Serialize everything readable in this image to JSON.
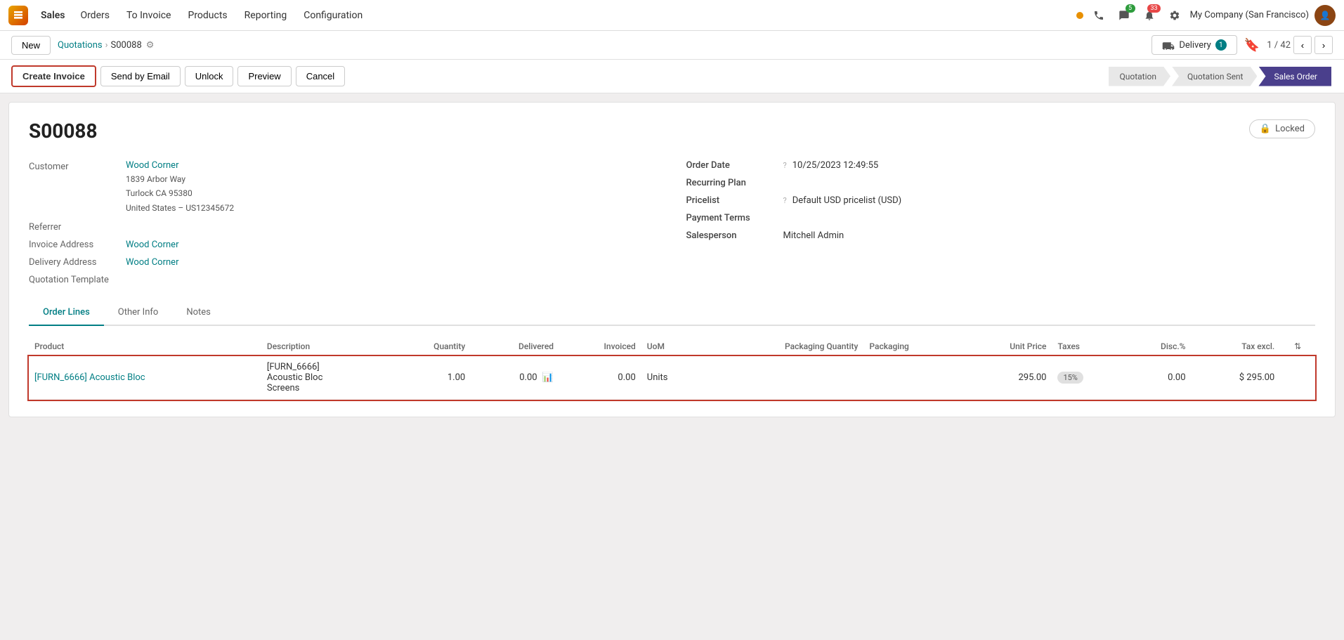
{
  "topnav": {
    "app_name": "Sales",
    "items": [
      {
        "label": "Orders",
        "active": false
      },
      {
        "label": "To Invoice",
        "active": false
      },
      {
        "label": "Products",
        "active": false
      },
      {
        "label": "Reporting",
        "active": false
      },
      {
        "label": "Configuration",
        "active": false
      }
    ],
    "chat_badge": "5",
    "activity_badge": "33",
    "company": "My Company (San Francisco)"
  },
  "breadcrumb": {
    "new_label": "New",
    "parent_label": "Quotations",
    "current_label": "S00088",
    "delivery_label": "Delivery",
    "delivery_count": "1",
    "pagination": "1 / 42"
  },
  "actions": {
    "create_invoice": "Create Invoice",
    "send_by_email": "Send by Email",
    "unlock": "Unlock",
    "preview": "Preview",
    "cancel": "Cancel"
  },
  "status_steps": [
    {
      "label": "Quotation",
      "active": false
    },
    {
      "label": "Quotation Sent",
      "active": false
    },
    {
      "label": "Sales Order",
      "active": true
    }
  ],
  "document": {
    "id": "S00088",
    "locked_label": "Locked",
    "customer_label": "Customer",
    "customer_name": "Wood Corner",
    "customer_address_line1": "1839 Arbor Way",
    "customer_address_line2": "Turlock CA 95380",
    "customer_address_line3": "United States – US12345672",
    "referrer_label": "Referrer",
    "invoice_address_label": "Invoice Address",
    "invoice_address_value": "Wood Corner",
    "delivery_address_label": "Delivery Address",
    "delivery_address_value": "Wood Corner",
    "quotation_template_label": "Quotation Template",
    "order_date_label": "Order Date",
    "order_date_value": "10/25/2023 12:49:55",
    "recurring_plan_label": "Recurring Plan",
    "pricelist_label": "Pricelist",
    "pricelist_value": "Default USD pricelist (USD)",
    "payment_terms_label": "Payment Terms",
    "salesperson_label": "Salesperson",
    "salesperson_value": "Mitchell Admin"
  },
  "tabs": [
    {
      "label": "Order Lines",
      "active": true
    },
    {
      "label": "Other Info",
      "active": false
    },
    {
      "label": "Notes",
      "active": false
    }
  ],
  "table": {
    "columns": [
      {
        "label": "Product"
      },
      {
        "label": "Description"
      },
      {
        "label": "Quantity"
      },
      {
        "label": "Delivered"
      },
      {
        "label": "Invoiced"
      },
      {
        "label": "UoM"
      },
      {
        "label": "Packaging Quantity"
      },
      {
        "label": "Packaging"
      },
      {
        "label": "Unit Price"
      },
      {
        "label": "Taxes"
      },
      {
        "label": "Disc.%"
      },
      {
        "label": "Tax excl."
      },
      {
        "label": "⇅"
      }
    ],
    "rows": [
      {
        "product_ref": "[FURN_6666] Acoustic Bloc",
        "description_line1": "[FURN_6666]",
        "description_line2": "Acoustic Bloc",
        "description_line3": "Screens",
        "quantity": "1.00",
        "delivered": "0.00",
        "invoiced": "0.00",
        "uom": "Units",
        "packaging_quantity": "",
        "packaging": "",
        "unit_price": "295.00",
        "taxes": "15%",
        "discount": "0.00",
        "tax_excl": "$ 295.00"
      }
    ]
  }
}
